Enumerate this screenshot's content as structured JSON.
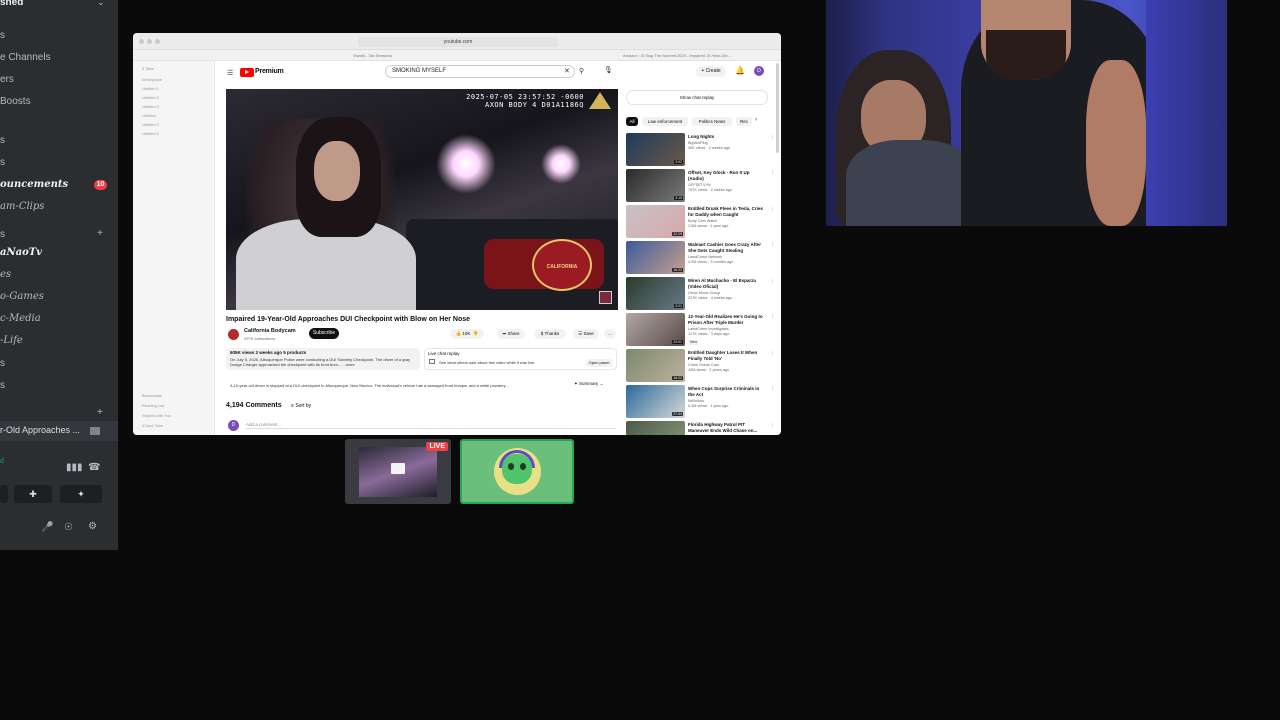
{
  "sidebar": {
    "server_name": "shed",
    "channels": [
      {
        "label": "s"
      },
      {
        "label": "e Channels"
      },
      {
        "label": "ers"
      },
      {
        "label": "Boosts"
      },
      {
        "label": "s"
      },
      {
        "label": "s"
      },
      {
        "label": "ouncements",
        "badge": "10"
      },
      {
        "label": "am-Clips"
      },
      {
        "label": "s"
      },
      {
        "label": "aNaoTv"
      },
      {
        "label": "es"
      },
      {
        "label": "o-Games"
      },
      {
        "label": "c-Media"
      },
      {
        "label": "-Life"
      },
      {
        "label": "s"
      },
      {
        "label": "s"
      }
    ],
    "voice_activity": "r-Old Approaches ...",
    "voice_status": "d"
  },
  "browser": {
    "url": "youtube.com",
    "tabs": [
      "Vivaldi - Tab Sessions",
      "Amazon : ID Bug The Summit 2025 - Impaired 19-Year-Old..."
    ],
    "sidebar_items": [
      "3 Tabs",
      "Workspace",
      "Untitled 1",
      "Untitled 2",
      "Untitled 3",
      "Untitled",
      "Untitled 5",
      "Untitled 6",
      "Bookmarks",
      "Reading List",
      "Shared with You",
      "iCloud Tabs"
    ]
  },
  "youtube": {
    "brand": "Premium",
    "search_query": "SMOKING MYSELF",
    "create_label": "Create",
    "avatar_letter": "D",
    "video": {
      "overlay_time": "2025-07-05 23:57:52 -0600",
      "overlay_id": "AXON BODY 4 D01A1186Q",
      "badge_text": "CALIFORNIA BODYCAM"
    },
    "title": "Impaired 19-Year-Old Approaches DUI Checkpoint with Blow on Her Nose",
    "channel": "California Bodycam",
    "subscribers": "297K subscribers",
    "subscribe_label": "Subscribe",
    "likes": "10K",
    "share_label": "Share",
    "thanks_label": "Thanks",
    "save_label": "Save",
    "more_label": "...",
    "desc_stats": "605K views  2 weeks ago  5 products",
    "desc_text": "On July 5, 2025, Albuquerque Police were conducting a DUI Sobriety Checkpoint. The driver of a gray Dodge Charger approached the checkpoint with its front bum... ...more",
    "live_chat_heading": "Live chat replay",
    "live_chat_text": "See what others said about this video while it was live.",
    "open_panel_label": "Open panel",
    "ai_summary": "A 19-year-old driver is stopped at a DUI checkpoint in Albuquerque, New Mexico. The individual's vehicle has a damaged front bumper and a white powdery...",
    "summary_label": "Summary",
    "comments_count": "4,194 Comments",
    "sort_label": "Sort by",
    "comment_placeholder": "Add a comment...",
    "show_chat_replay": "Show chat replay",
    "chips": [
      "All",
      "Law enforcement",
      "Politics News",
      "Rec"
    ],
    "recommendations": [
      {
        "title": "Long Nights",
        "channel": "BigWetPlug",
        "meta": "40K views · 2 weeks ago",
        "duration": "3:02",
        "color1": "#1e3a5c",
        "color2": "#6a5a4a"
      },
      {
        "title": "Offset, Key Glock - Run It Up (Audio)",
        "channel": "OFFSETVVN",
        "meta": "757K views · 2 weeks ago",
        "duration": "3:19",
        "color1": "#2b2b2b",
        "color2": "#7a7a7a"
      },
      {
        "title": "Entitled Drunk Flees in Tesla, Cries for Daddy when Caught",
        "channel": "Body Cam Watch",
        "meta": "2.6M views · 1 year ago",
        "duration": "22:29",
        "color1": "#c8c2c8",
        "color2": "#d9a8a8"
      },
      {
        "title": "Walmart Cashier Goes Crazy After She Gets Caught Stealing",
        "channel": "LawdCrime Network",
        "meta": "4.9M views · 3 months ago",
        "duration": "16:22",
        "color1": "#3a5a9a",
        "color2": "#c8a090"
      },
      {
        "title": "Miren Al Muchacho - El Esparza (Video Oficial)",
        "channel": "Delux Music Group",
        "meta": "227K views · 4 weeks ago",
        "duration": "3:21",
        "color1": "#2a3a2a",
        "color2": "#6a7a8a"
      },
      {
        "title": "12-Year-Old Realizes He's Going to Prison After Triple Murder",
        "channel": "LawdCrime Investigates",
        "meta": "127K views · 3 days ago",
        "duration": "23:01",
        "color1": "#b0a8a0",
        "color2": "#5a4a4a",
        "new": "New"
      },
      {
        "title": "Entitled Daughter Loses It When Finally Told 'No'",
        "channel": "Crime Scene Cam",
        "meta": "10M views · 2 years ago",
        "duration": "16:22",
        "color1": "#7a8a6a",
        "color2": "#c0b0a0"
      },
      {
        "title": "When Cops Surprise Criminals in the Act",
        "channel": "MrBodies",
        "meta": "5.3M views · 1 year ago",
        "duration": "27:44",
        "color1": "#2a6a9a",
        "color2": "#d8d8d8"
      },
      {
        "title": "Florida Highway Patrol PIT Maneuver Ends Wild Chase on...",
        "channel": "",
        "meta": "",
        "duration": "",
        "color1": "#4a5a4a",
        "color2": "#8a9a7a"
      }
    ]
  },
  "stream": {
    "live_label": "LIVE"
  },
  "colors": {
    "discord_bg": "#2b2d31",
    "youtube_red": "#ff0000",
    "live_red": "#ed4245",
    "speaking_green": "#23a55a"
  }
}
